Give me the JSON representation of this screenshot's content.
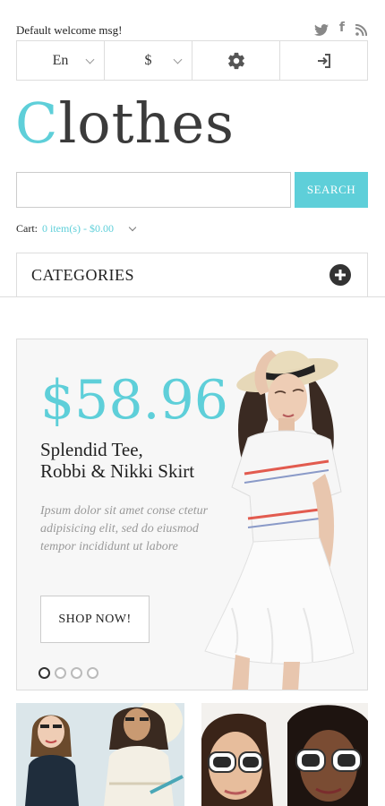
{
  "header": {
    "welcome": "Default welcome msg!",
    "social": [
      "twitter-icon",
      "facebook-icon",
      "rss-icon"
    ],
    "facebook_glyph": "f"
  },
  "selectors": {
    "language": "En",
    "currency": "$"
  },
  "logo": {
    "first_letter": "C",
    "rest": "lothes",
    "accent_color": "#5ecfd9"
  },
  "search": {
    "placeholder": "",
    "button_label": "SEARCH"
  },
  "cart": {
    "label": "Cart:",
    "value": "0 item(s) - $0.00"
  },
  "categories": {
    "label": "CATEGORIES"
  },
  "banner": {
    "price": "$58.96",
    "title_line1": "Splendid Tee,",
    "title_line2": "Robbi & Nikki Skirt",
    "description": "Ipsum dolor sit amet conse ctetur adipisicing elit, sed do eiusmod tempor incididunt ut labore",
    "button_label": "SHOP NOW!",
    "slides": 4,
    "active_slide": 1
  }
}
